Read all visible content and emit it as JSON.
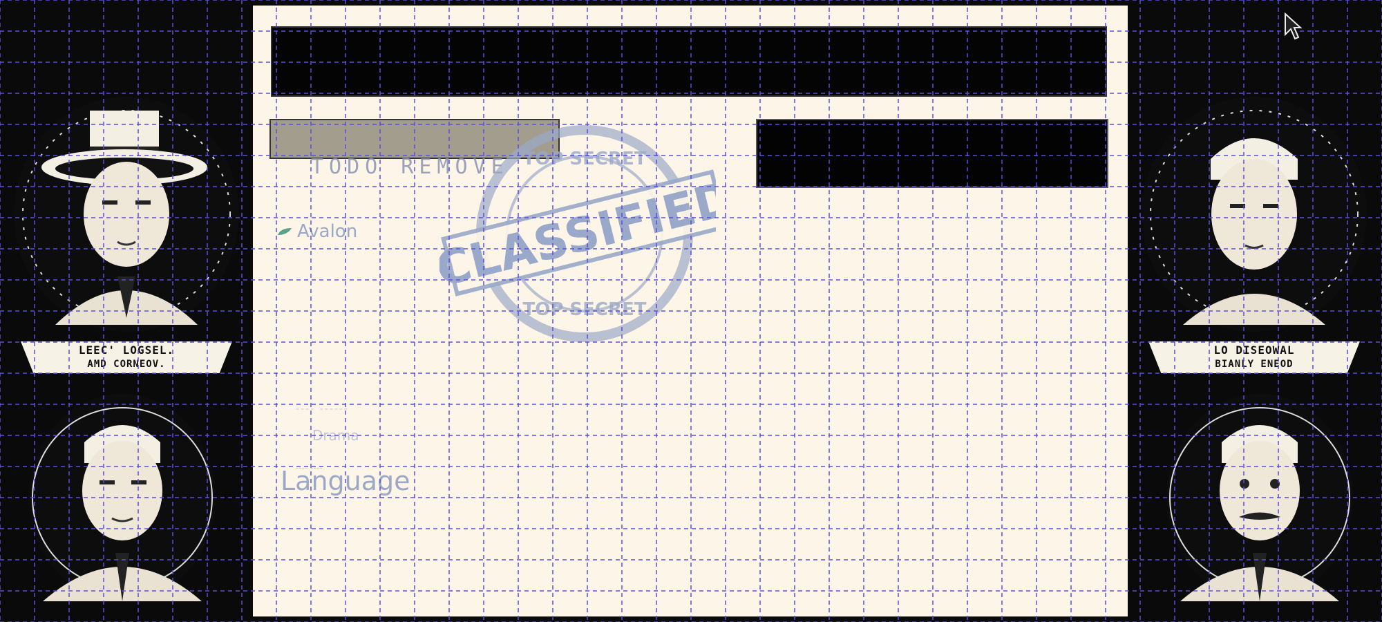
{
  "left_panel": {
    "banner_line1": "LEEC' LOGSEL.",
    "banner_line2": "AMD CORNEOV."
  },
  "right_panel": {
    "banner_line1": "LO DISEOWAL",
    "banner_line2": "BIANLY ENEOD"
  },
  "document": {
    "todo_text": "TODO REMOVE",
    "faction_label": "Avalon",
    "faded_line1": "---- ------",
    "faded_line2": "Drama",
    "faded_line3": "---- ----",
    "language_label": "Language"
  },
  "stamp": {
    "main": "CLASSIFIED",
    "top": "TOP SECRET",
    "bottom": "TOP SECRET",
    "color": "#9aa9c9"
  },
  "colors": {
    "paper": "#fdf6e8",
    "grid": "#5a4ee0",
    "ink": "#040404"
  }
}
